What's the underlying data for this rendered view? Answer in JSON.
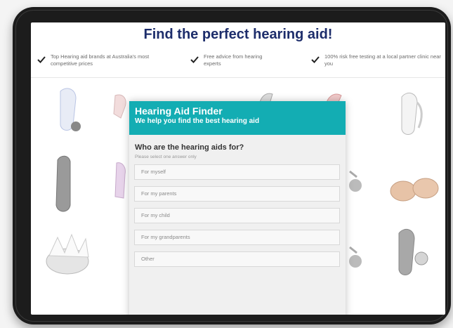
{
  "page": {
    "headline": "Find the perfect hearing aid!"
  },
  "benefits": [
    {
      "icon": "checkmark-icon",
      "text": "Top Hearing aid brands at Australia's most competitive prices"
    },
    {
      "icon": "checkmark-icon",
      "text": "Free advice from hearing experts"
    },
    {
      "icon": "checkmark-icon",
      "text": "100% risk free testing at a local partner clinic near you"
    }
  ],
  "finder": {
    "title": "Hearing Aid Finder",
    "subtitle": "We help you find the best hearing aid",
    "question": "Who are the hearing aids for?",
    "hint": "Please select one answer only",
    "options": [
      "For myself",
      "For my parents",
      "For my child",
      "For my grandparents",
      "Other"
    ]
  },
  "colors": {
    "headline": "#1d2d6b",
    "finder_header": "#13adb3",
    "tablet_frame": "#1c1c1c"
  }
}
